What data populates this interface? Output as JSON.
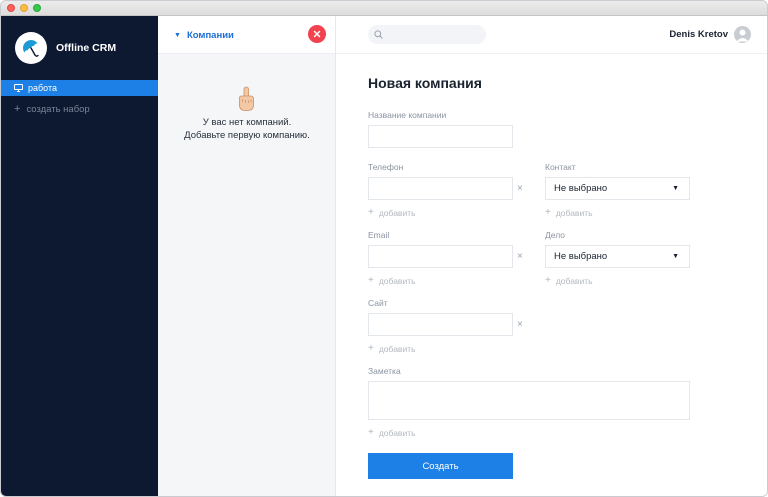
{
  "sidebar": {
    "app_name": "Offline CRM",
    "active_item": "работа",
    "add_item": "создать набор"
  },
  "companies_panel": {
    "title": "Компании",
    "empty_line1": "У вас нет компаний.",
    "empty_line2": "Добавьте первую компанию."
  },
  "topbar": {
    "search_placeholder": "",
    "user_name": "Denis Kretov"
  },
  "form": {
    "title": "Новая компания",
    "company_name_label": "Название компании",
    "phone_label": "Телефон",
    "contact_label": "Контакт",
    "contact_value": "Не выбрано",
    "email_label": "Email",
    "deal_label": "Дело",
    "deal_value": "Не выбрано",
    "site_label": "Сайт",
    "note_label": "Заметка",
    "add_label": "добавить",
    "remove_symbol": "×",
    "submit_label": "Создать"
  },
  "colors": {
    "sidebar_bg": "#0d1831",
    "accent": "#1c80e6",
    "close_red": "#f0424f"
  },
  "icons": {
    "logo": "umbrella-icon",
    "nav_active": "monitor-icon",
    "empty_state": "pointing-hand-icon",
    "search": "search-icon",
    "avatar": "user-icon"
  }
}
